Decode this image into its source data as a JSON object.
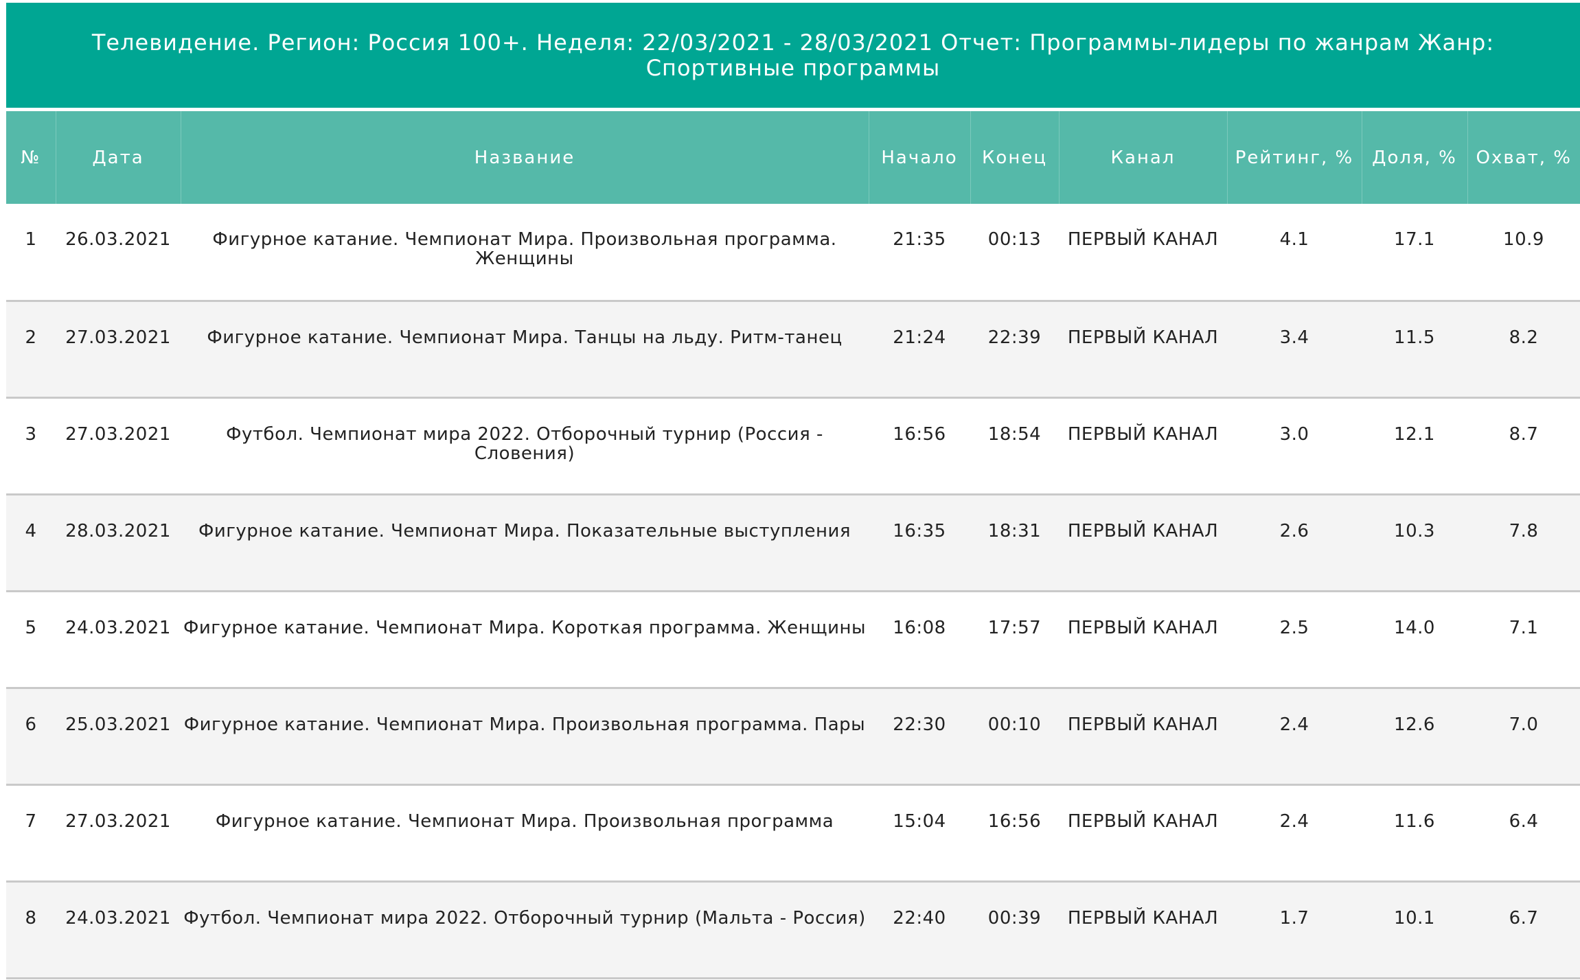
{
  "report": {
    "title": "Телевидение. Регион: Россия 100+. Неделя: 22/03/2021 - 28/03/2021 Отчет: Программы-лидеры по жанрам Жанр: Спортивные программы"
  },
  "table": {
    "headers": {
      "num": "№",
      "date": "Дата",
      "name": "Название",
      "start": "Начало",
      "end": "Конец",
      "channel": "Канал",
      "rating": "Рейтинг, %",
      "share": "Доля, %",
      "reach": "Охват, %"
    },
    "rows": [
      {
        "num": "1",
        "date": "26.03.2021",
        "name": "Фигурное катание. Чемпионат Мира. Произвольная программа. Женщины",
        "start": "21:35",
        "end": "00:13",
        "channel": "ПЕРВЫЙ КАНАЛ",
        "rating": "4.1",
        "share": "17.1",
        "reach": "10.9"
      },
      {
        "num": "2",
        "date": "27.03.2021",
        "name": "Фигурное катание. Чемпионат Мира. Танцы на льду. Ритм-танец",
        "start": "21:24",
        "end": "22:39",
        "channel": "ПЕРВЫЙ КАНАЛ",
        "rating": "3.4",
        "share": "11.5",
        "reach": "8.2"
      },
      {
        "num": "3",
        "date": "27.03.2021",
        "name": "Футбол. Чемпионат мира 2022. Отборочный турнир (Россия - Словения)",
        "start": "16:56",
        "end": "18:54",
        "channel": "ПЕРВЫЙ КАНАЛ",
        "rating": "3.0",
        "share": "12.1",
        "reach": "8.7"
      },
      {
        "num": "4",
        "date": "28.03.2021",
        "name": "Фигурное катание. Чемпионат Мира. Показательные выступления",
        "start": "16:35",
        "end": "18:31",
        "channel": "ПЕРВЫЙ КАНАЛ",
        "rating": "2.6",
        "share": "10.3",
        "reach": "7.8"
      },
      {
        "num": "5",
        "date": "24.03.2021",
        "name": "Фигурное катание. Чемпионат Мира. Короткая программа. Женщины",
        "start": "16:08",
        "end": "17:57",
        "channel": "ПЕРВЫЙ КАНАЛ",
        "rating": "2.5",
        "share": "14.0",
        "reach": "7.1"
      },
      {
        "num": "6",
        "date": "25.03.2021",
        "name": "Фигурное катание. Чемпионат Мира. Произвольная программа. Пары",
        "start": "22:30",
        "end": "00:10",
        "channel": "ПЕРВЫЙ КАНАЛ",
        "rating": "2.4",
        "share": "12.6",
        "reach": "7.0"
      },
      {
        "num": "7",
        "date": "27.03.2021",
        "name": "Фигурное катание. Чемпионат Мира. Произвольная программа",
        "start": "15:04",
        "end": "16:56",
        "channel": "ПЕРВЫЙ КАНАЛ",
        "rating": "2.4",
        "share": "11.6",
        "reach": "6.4"
      },
      {
        "num": "8",
        "date": "24.03.2021",
        "name": "Футбол. Чемпионат мира 2022. Отборочный турнир (Мальта - Россия)",
        "start": "22:40",
        "end": "00:39",
        "channel": "ПЕРВЫЙ КАНАЛ",
        "rating": "1.7",
        "share": "10.1",
        "reach": "6.7"
      }
    ]
  },
  "colors": {
    "title_bg": "#00a693",
    "header_bg": "#55b9a9",
    "row_alt_bg": "#f4f4f4",
    "row_divider": "#c9c9c9"
  }
}
